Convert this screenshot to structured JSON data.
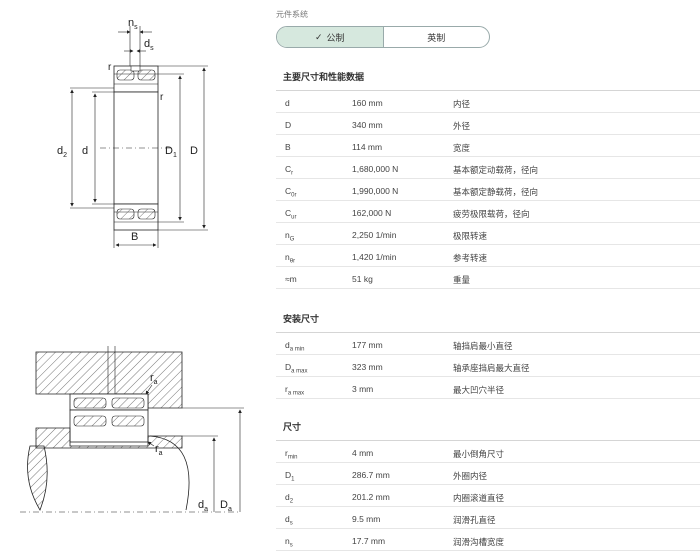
{
  "unit_system_label": "元件系统",
  "toggle": {
    "metric": "公制",
    "imperial": "英制"
  },
  "drawing_labels": {
    "ns": "n",
    "ns_sub": "s",
    "ds": "d",
    "ds_sub": "s",
    "r1": "r",
    "r2": "r",
    "d2": "d",
    "d2_sub": "2",
    "d": "d",
    "D1": "D",
    "D1_sub": "1",
    "D": "D",
    "B": "B",
    "ra1": "r",
    "ra1_sub": "a",
    "ra2": "r",
    "ra2_sub": "a",
    "da": "d",
    "da_sub": "a",
    "Da": "D",
    "Da_sub": "a"
  },
  "sections": [
    {
      "title": "主要尺寸和性能数据",
      "rows": [
        {
          "sym": "d",
          "sub": "",
          "val": "160 mm",
          "desc": "内径"
        },
        {
          "sym": "D",
          "sub": "",
          "val": "340 mm",
          "desc": "外径"
        },
        {
          "sym": "B",
          "sub": "",
          "val": "114 mm",
          "desc": "宽度"
        },
        {
          "sym": "C",
          "sub": "r",
          "val": "1,680,000 N",
          "desc": "基本额定动载荷，径向"
        },
        {
          "sym": "C",
          "sub": "0r",
          "val": "1,990,000 N",
          "desc": "基本额定静载荷，径向"
        },
        {
          "sym": "C",
          "sub": "ur",
          "val": "162,000 N",
          "desc": "疲劳极限载荷，径向"
        },
        {
          "sym": "n",
          "sub": "G",
          "val": "2,250 1/min",
          "desc": "极限转速"
        },
        {
          "sym": "n",
          "sub": "θr",
          "val": "1,420 1/min",
          "desc": "参考转速"
        },
        {
          "sym": "≈m",
          "sub": "",
          "val": "51 kg",
          "desc": "重量"
        }
      ]
    },
    {
      "title": "安装尺寸",
      "rows": [
        {
          "sym": "d",
          "sub": "a min",
          "val": "177 mm",
          "desc": "轴挡肩最小直径"
        },
        {
          "sym": "D",
          "sub": "a max",
          "val": "323 mm",
          "desc": "轴承座挡肩最大直径"
        },
        {
          "sym": "r",
          "sub": "a max",
          "val": "3 mm",
          "desc": "最大凹穴半径"
        }
      ]
    },
    {
      "title": "尺寸",
      "rows": [
        {
          "sym": "r",
          "sub": "min",
          "val": "4 mm",
          "desc": "最小倒角尺寸"
        },
        {
          "sym": "D",
          "sub": "1",
          "val": "286.7 mm",
          "desc": "外圈内径"
        },
        {
          "sym": "d",
          "sub": "2",
          "val": "201.2 mm",
          "desc": "内圈滚道直径"
        },
        {
          "sym": "d",
          "sub": "s",
          "val": "9.5 mm",
          "desc": "润滑孔直径"
        },
        {
          "sym": "n",
          "sub": "s",
          "val": "17.7 mm",
          "desc": "润滑沟槽宽度"
        }
      ]
    }
  ]
}
